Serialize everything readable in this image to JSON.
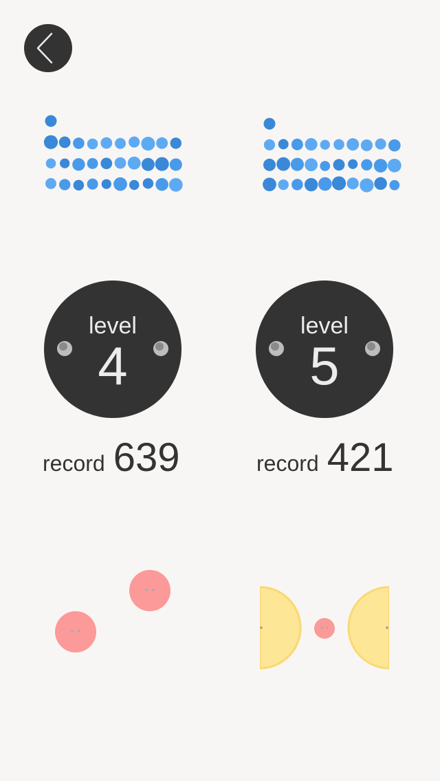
{
  "nav": {
    "back_icon": "chevron-left-icon"
  },
  "colors": {
    "background": "#f8f6f4",
    "dark": "#333333",
    "blue_light": "#5eaaf2",
    "blue_mid": "#4a9aea",
    "blue_dark": "#3a88d8",
    "pink": "#fb9a98",
    "yellow": "#fde796"
  },
  "levels": [
    {
      "word": "level",
      "number": "4",
      "record_label": "record",
      "record_value": "639"
    },
    {
      "word": "level",
      "number": "5",
      "record_label": "record",
      "record_value": "421"
    }
  ]
}
